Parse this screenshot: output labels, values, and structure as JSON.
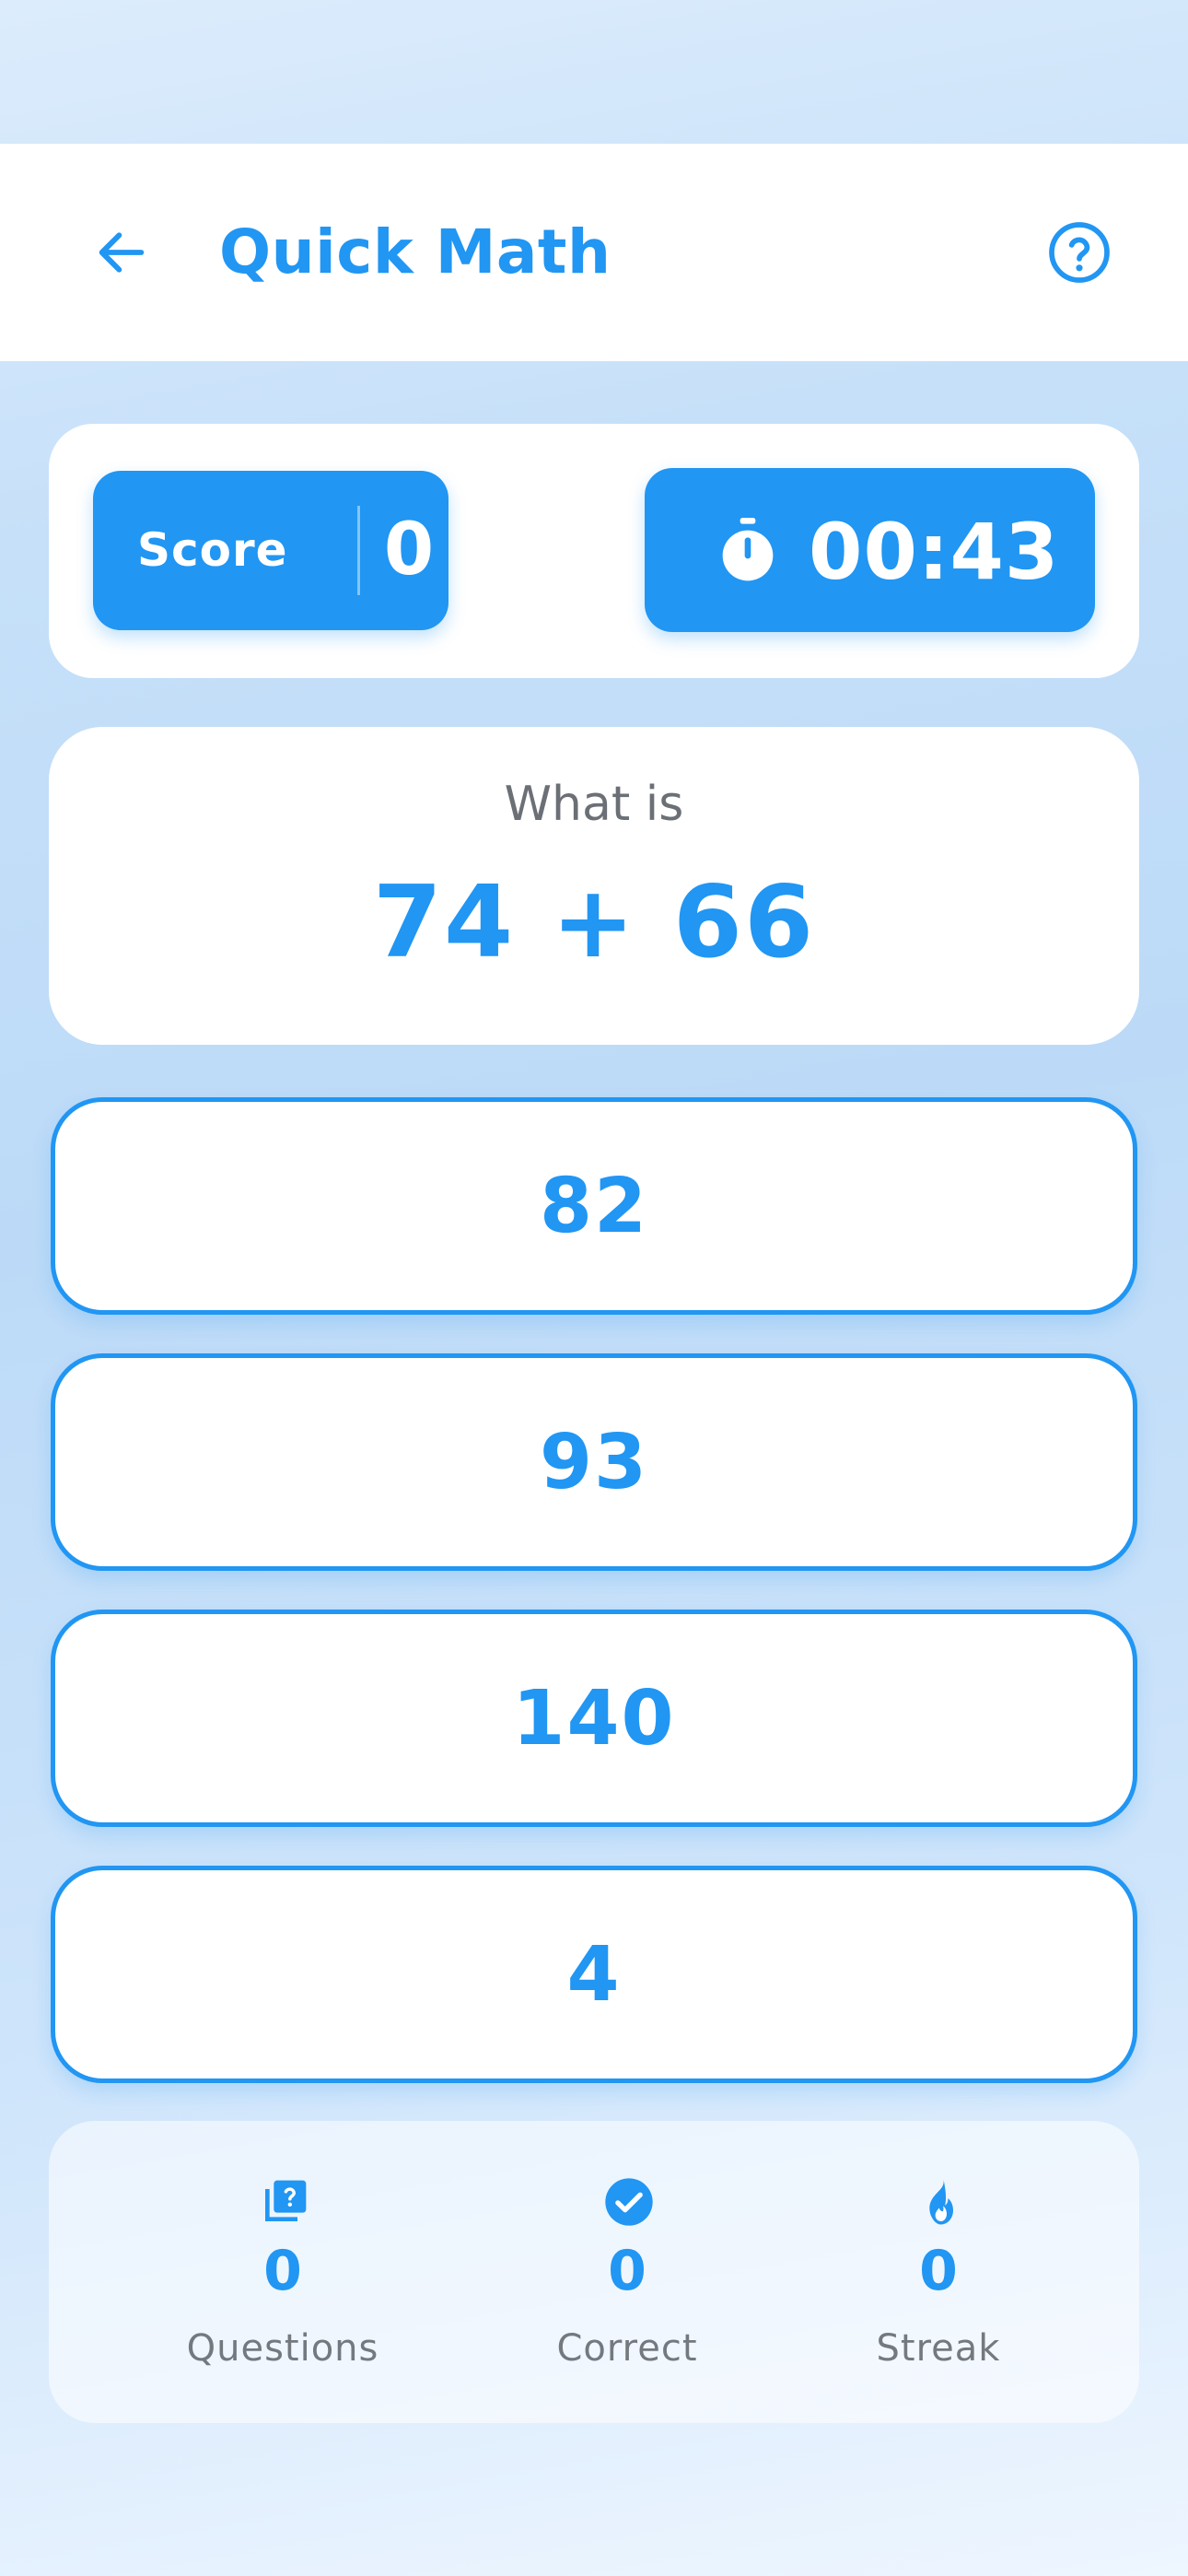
{
  "app": {
    "title": "Quick Math",
    "accent_color": "#2196f3",
    "back_icon": "arrow-left-icon",
    "help_icon": "help-circle-icon"
  },
  "status": {
    "score_label": "Score",
    "score_value": "0",
    "timer_icon": "stopwatch-icon",
    "timer_value": "00:43"
  },
  "question": {
    "prompt": "What is",
    "expression": "74 + 66"
  },
  "answers": [
    {
      "label": "82"
    },
    {
      "label": "93"
    },
    {
      "label": "140"
    },
    {
      "label": "4"
    }
  ],
  "stats": [
    {
      "icon": "question-cards-icon",
      "value": "0",
      "label": "Questions"
    },
    {
      "icon": "check-circle-icon",
      "value": "0",
      "label": "Correct"
    },
    {
      "icon": "fire-icon",
      "value": "0",
      "label": "Streak"
    }
  ]
}
